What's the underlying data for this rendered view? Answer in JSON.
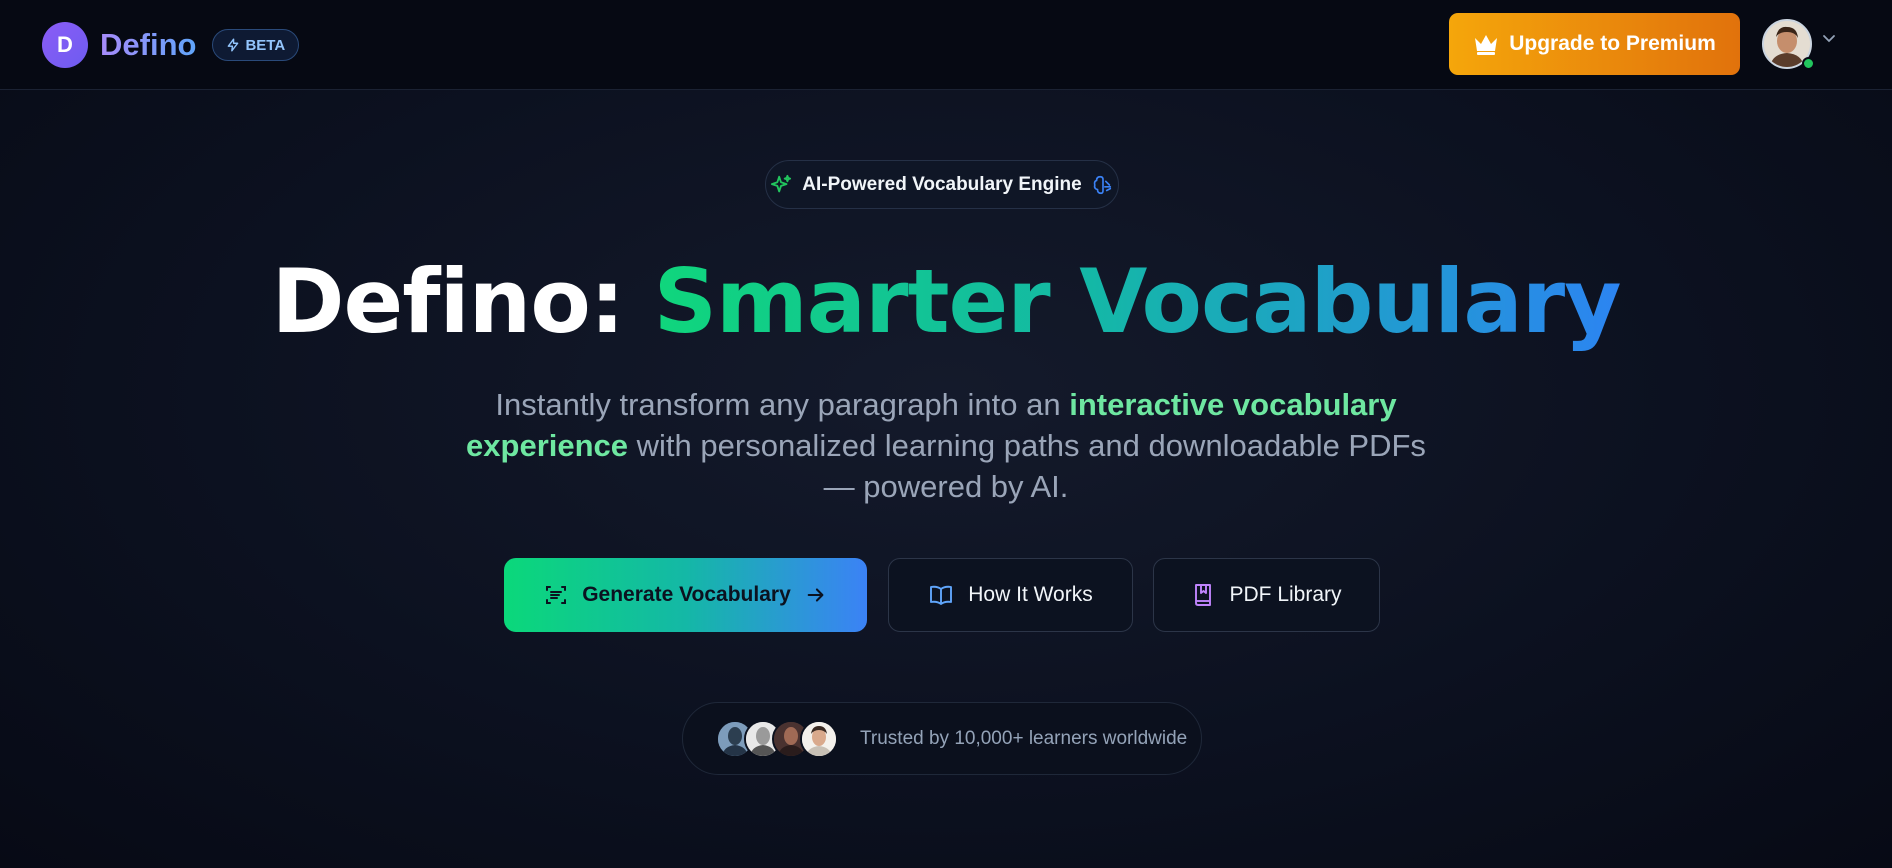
{
  "brand": {
    "initial": "D",
    "name": "Defino",
    "badge": "BETA"
  },
  "header": {
    "upgrade_label": "Upgrade to Premium"
  },
  "hero": {
    "engine_label": "AI-Powered Vocabulary Engine",
    "headline_prefix": "Defino:",
    "headline_highlight": "Smarter Vocabulary",
    "subtitle_part1": "Instantly transform any paragraph into an ",
    "subtitle_emphasis": "interactive vocabulary experience",
    "subtitle_part2": " with personalized learning paths and downloadable PDFs — powered by AI."
  },
  "actions": {
    "generate": "Generate Vocabulary",
    "how_it_works": "How It Works",
    "pdf_library": "PDF Library"
  },
  "trust": {
    "text": "Trusted by 10,000+ learners worldwide"
  },
  "colors": {
    "accent_green": "#10d67c",
    "accent_blue": "#2c84f2",
    "upgrade_orange": "#f5a60b",
    "brand_purple": "#8b5cf6"
  }
}
